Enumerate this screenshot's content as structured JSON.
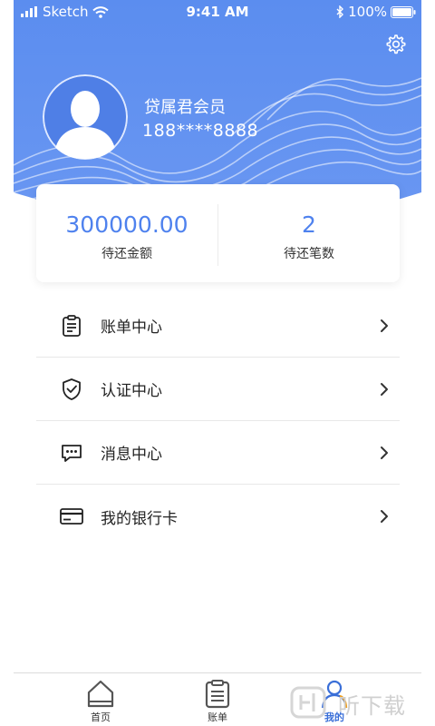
{
  "status_bar": {
    "carrier": "Sketch",
    "time": "9:41 AM",
    "battery": "100%"
  },
  "profile": {
    "name": "贷属君会员",
    "phone": "188****8888"
  },
  "summary": {
    "amount_value": "300000.00",
    "amount_label": "待还金额",
    "count_value": "2",
    "count_label": "待还笔数"
  },
  "menu": {
    "items": [
      {
        "label": "账单中心",
        "icon": "clipboard-icon"
      },
      {
        "label": "认证中心",
        "icon": "shield-check-icon"
      },
      {
        "label": "消息中心",
        "icon": "chat-bubble-icon"
      },
      {
        "label": "我的银行卡",
        "icon": "bank-card-icon"
      }
    ]
  },
  "tabs": [
    {
      "label": "首页",
      "icon": "home-icon",
      "active": false
    },
    {
      "label": "账单",
      "icon": "bill-icon",
      "active": false
    },
    {
      "label": "我的",
      "icon": "user-icon",
      "active": true
    }
  ],
  "watermark": {
    "text": "听下载"
  },
  "colors": {
    "header_blue": "#5b8def",
    "accent_blue": "#4f82ee",
    "tab_active": "#3a6fd8"
  }
}
